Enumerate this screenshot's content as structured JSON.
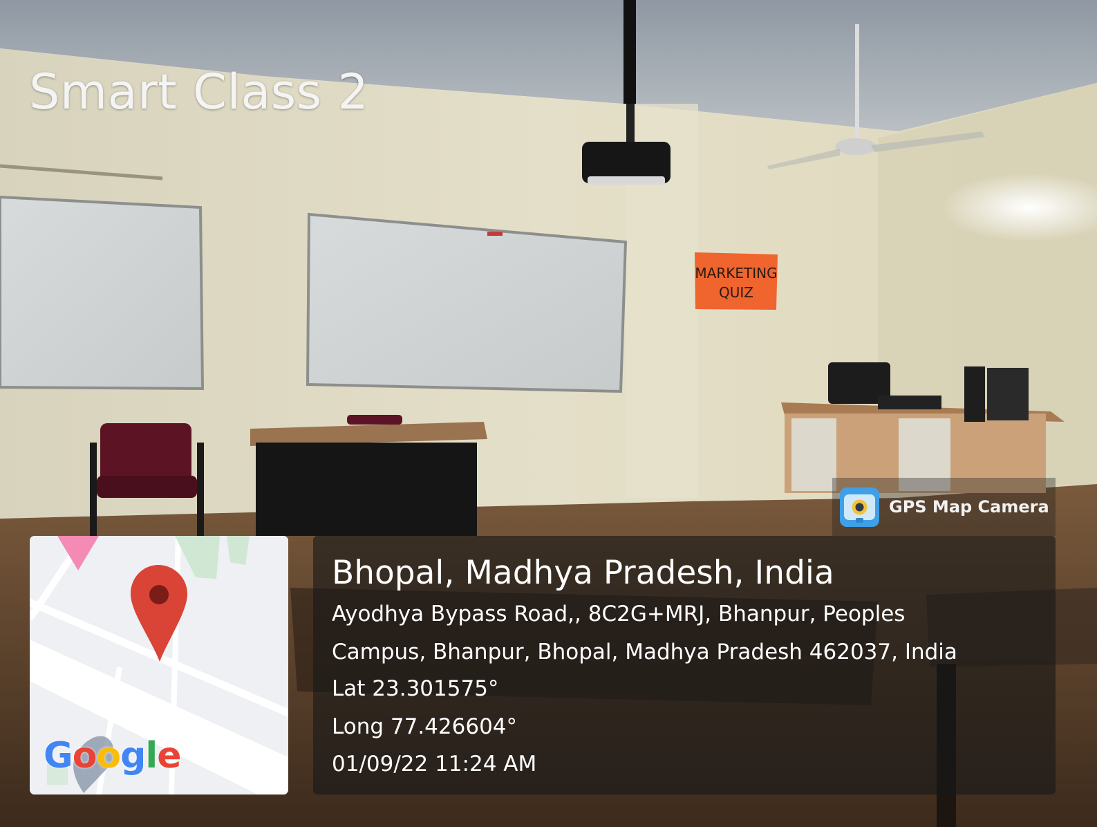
{
  "overlay_title": "Smart Class 2",
  "wall_poster": {
    "line1": "MARKETING",
    "line2": "QUIZ",
    "color": "#f0642e"
  },
  "gps_badge": {
    "label": "GPS Map Camera",
    "icon": "gps-map-camera-app-icon"
  },
  "map": {
    "brand": "Google",
    "pin_color": "#d94436"
  },
  "location": {
    "city": "Bhopal, Madhya Pradesh, India",
    "address_line1": "Ayodhya Bypass Road,, 8C2G+MRJ, Bhanpur, Peoples",
    "address_line2": "Campus, Bhanpur, Bhopal, Madhya Pradesh 462037, India",
    "lat": "Lat 23.301575°",
    "long": "Long 77.426604°",
    "datetime": "01/09/22 11:24 AM"
  }
}
